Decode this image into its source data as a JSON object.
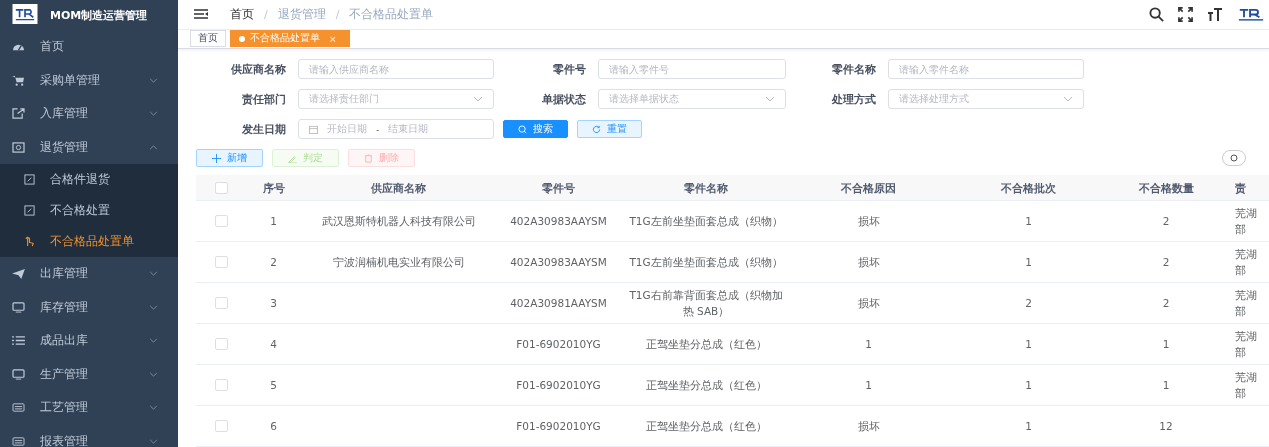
{
  "app": {
    "title": "MOM制造运营管理"
  },
  "sidebar": {
    "items": [
      {
        "label": "首页"
      },
      {
        "label": "采购单管理",
        "expanded": false
      },
      {
        "label": "入库管理",
        "expanded": false
      },
      {
        "label": "退货管理",
        "expanded": true,
        "children": [
          {
            "label": "合格件退货",
            "selected": false
          },
          {
            "label": "不合格处置",
            "selected": false
          },
          {
            "label": "不合格品处置单",
            "selected": true
          }
        ]
      },
      {
        "label": "出库管理",
        "expanded": false
      },
      {
        "label": "库存管理",
        "expanded": false
      },
      {
        "label": "成品出库",
        "expanded": false
      },
      {
        "label": "生产管理",
        "expanded": false
      },
      {
        "label": "工艺管理",
        "expanded": false
      },
      {
        "label": "报表管理",
        "expanded": false
      }
    ]
  },
  "breadcrumb": {
    "separator": "/",
    "items": [
      "首页",
      "退货管理",
      "不合格品处置单"
    ]
  },
  "tabs": [
    {
      "label": "首页",
      "selected": false
    },
    {
      "label": "不合格品处置单",
      "selected": true,
      "close": "×"
    }
  ],
  "filters": [
    {
      "label": "供应商名称",
      "kind": "input",
      "placeholder": "请输入供应商名称"
    },
    {
      "label": "零件号",
      "kind": "input",
      "placeholder": "请输入零件号"
    },
    {
      "label": "零件名称",
      "kind": "input",
      "placeholder": "请输入零件名称"
    },
    {
      "label": "责任部门",
      "kind": "select",
      "placeholder": "请选择责任部门"
    },
    {
      "label": "单据状态",
      "kind": "select",
      "placeholder": "请选择单据状态"
    },
    {
      "label": "处理方式",
      "kind": "select",
      "placeholder": "请选择处理方式"
    },
    {
      "label": "发生日期",
      "kind": "daterange",
      "start_placeholder": "开始日期",
      "separator": "-",
      "end_placeholder": "结束日期"
    }
  ],
  "search_buttons": [
    {
      "label": "搜索",
      "kind": "primary"
    },
    {
      "label": "重置",
      "kind": "plain"
    }
  ],
  "toolbar": [
    {
      "label": "新增",
      "kind": "add",
      "disabled": false
    },
    {
      "label": "判定",
      "kind": "judge",
      "disabled": true
    },
    {
      "label": "删除",
      "kind": "delete",
      "disabled": true
    }
  ],
  "table": {
    "all_checked": false,
    "columns": [
      "序号",
      "供应商名称",
      "零件号",
      "零件名称",
      "不合格原因",
      "不合格批次",
      "不合格数量",
      "责"
    ],
    "rows": [
      {
        "checked": false,
        "cells": [
          "1",
          "武汉恩斯特机器人科技有限公司",
          "402A30983AAYSM",
          "T1G左前坐垫面套总成（织物）",
          "损坏",
          "1",
          "2",
          "芜湖部"
        ]
      },
      {
        "checked": false,
        "cells": [
          "2",
          "宁波润楠机电实业有限公司",
          "402A30983AAYSM",
          "T1G左前坐垫面套总成（织物）",
          "损坏",
          "1",
          "2",
          "芜湖部"
        ]
      },
      {
        "checked": false,
        "cells": [
          "3",
          "",
          "402A30981AAYSM",
          "T1G右前靠背面套总成（织物加热 SAB）",
          "损坏",
          "2",
          "2",
          "芜湖部"
        ]
      },
      {
        "checked": false,
        "cells": [
          "4",
          "",
          "F01-6902010YG",
          "正驾坐垫分总成（红色）",
          "1",
          "1",
          "1",
          "芜湖部"
        ]
      },
      {
        "checked": false,
        "cells": [
          "5",
          "",
          "F01-6902010YG",
          "正驾坐垫分总成（红色）",
          "1",
          "1",
          "1",
          "芜湖部"
        ]
      },
      {
        "checked": false,
        "cells": [
          "6",
          "",
          "F01-6902010YG",
          "正驾坐垫分总成（红色）",
          "损坏",
          "1",
          "12",
          ""
        ]
      }
    ]
  }
}
